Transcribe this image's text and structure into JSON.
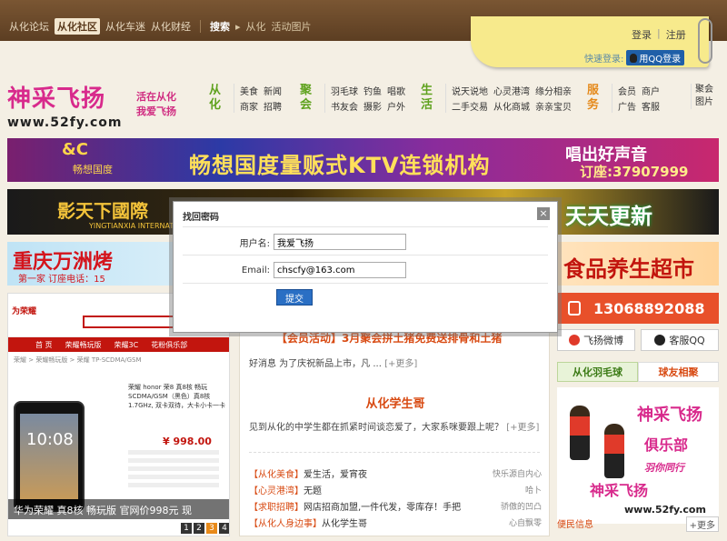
{
  "topnav": {
    "items": [
      "从化论坛",
      "从化社区",
      "从化车迷",
      "从化财经"
    ],
    "active_index": 1,
    "search": "搜索",
    "search_arrow": "▸",
    "search_scope": "从化",
    "search_link": "活动图片"
  },
  "login": {
    "login": "登录",
    "sep": "|",
    "register": "注册",
    "quick_label": "快速登录:",
    "qq_button": "用QQ登录"
  },
  "logo": {
    "title": "神采飞扬",
    "url": "www.52fy.com",
    "slogan_line1": "活在从化",
    "slogan_line2": "我爱飞扬"
  },
  "nav": {
    "groups": [
      {
        "cat": "从化",
        "links": [
          "美食",
          "新闻",
          "商家",
          "招聘"
        ]
      },
      {
        "cat": "聚会",
        "links": [
          "羽毛球",
          "钓鱼",
          "唱歌",
          "书友会",
          "摄影",
          "户外"
        ]
      },
      {
        "cat": "生活",
        "links": [
          "说天说地",
          "心灵港湾",
          "缘分相亲",
          "二手交易",
          "从化商城",
          "亲亲宝贝"
        ]
      },
      {
        "cat": "服务",
        "links": [
          "会员",
          "商户",
          "广告",
          "客服"
        ]
      }
    ],
    "photos": [
      "聚会",
      "图片"
    ]
  },
  "banners": {
    "b1": {
      "brand": "&C",
      "brand_sub": "畅想国度",
      "headline": "畅想国度量贩式KTV连锁机构",
      "right_top": "唱出好声音",
      "right_bottom": "订座:37907999"
    },
    "b2": {
      "title": "影天下國際",
      "sub": "YINGTIANXIA INTERNATIO",
      "right": "天天更新"
    },
    "b3": {
      "title": "重庆万洲烤",
      "sub": "第一家   订座电话：15",
      "right": "食品养生超市"
    }
  },
  "product": {
    "shop": "为荣耀",
    "tabs": [
      "首 页",
      "荣耀畅玩版",
      "荣耀3C",
      "花粉俱乐部"
    ],
    "crumb": "荣耀 > 荣耀畅玩版 > 荣耀 TP-SCDMA/GSM",
    "clock": "10:08",
    "desc": "荣耀 honor 荣8 真8核 畅玩 SCDMA/GSM（黑色）真8核1.7GHz, 双卡双待，大卡小卡一卡",
    "price": "¥ 998.00",
    "caption": "华为荣耀 真8核 畅玩版 官网价998元 现",
    "pages": [
      "1",
      "2",
      "3",
      "4",
      "5"
    ],
    "active_page": 2
  },
  "middle": {
    "headline": "【会员活动】3月聚会拼土猪免费送排骨和土猪",
    "p1": "好消息 为了庆祝新品上市，凡 ...",
    "p1_more": "[+更多]",
    "headline2": "从化学生哥",
    "p2": "见到从化的中学生都在抓紧时间谈恋爱了，大家系咪要跟上呢？",
    "p2_more": "[+更多]",
    "news": [
      {
        "tag": "【从化美食】",
        "title": "爱生活，爱宵夜",
        "src": "快乐源自内心"
      },
      {
        "tag": "【心灵港湾】",
        "title": "无题",
        "src": "哈卜"
      },
      {
        "tag": "【求职招聘】",
        "title": "网店招商加盟,一件代发，零库存！手把",
        "src": "骄傲的凹凸"
      },
      {
        "tag": "【从化人身边事】",
        "title": "从化学生哥",
        "src": "心自飘零"
      }
    ]
  },
  "right": {
    "phone": "13068892088",
    "weibo": "飞扬微博",
    "qq": "客服QQ",
    "tab1": "从化羽毛球",
    "tab2": "球友相聚",
    "club1": "神采飞扬",
    "club2": "俱乐部",
    "club3": "羽你同行",
    "club4": "神采飞扬",
    "club5": "www.52fy.com",
    "bottom_left": "便民信息",
    "bottom_right": "+更多"
  },
  "modal": {
    "title": "找回密码",
    "close": "×",
    "username_label": "用户名:",
    "username_value": "我爱飞扬",
    "email_label": "Email:",
    "email_value": "chscfy@163.com",
    "submit": "提交"
  }
}
